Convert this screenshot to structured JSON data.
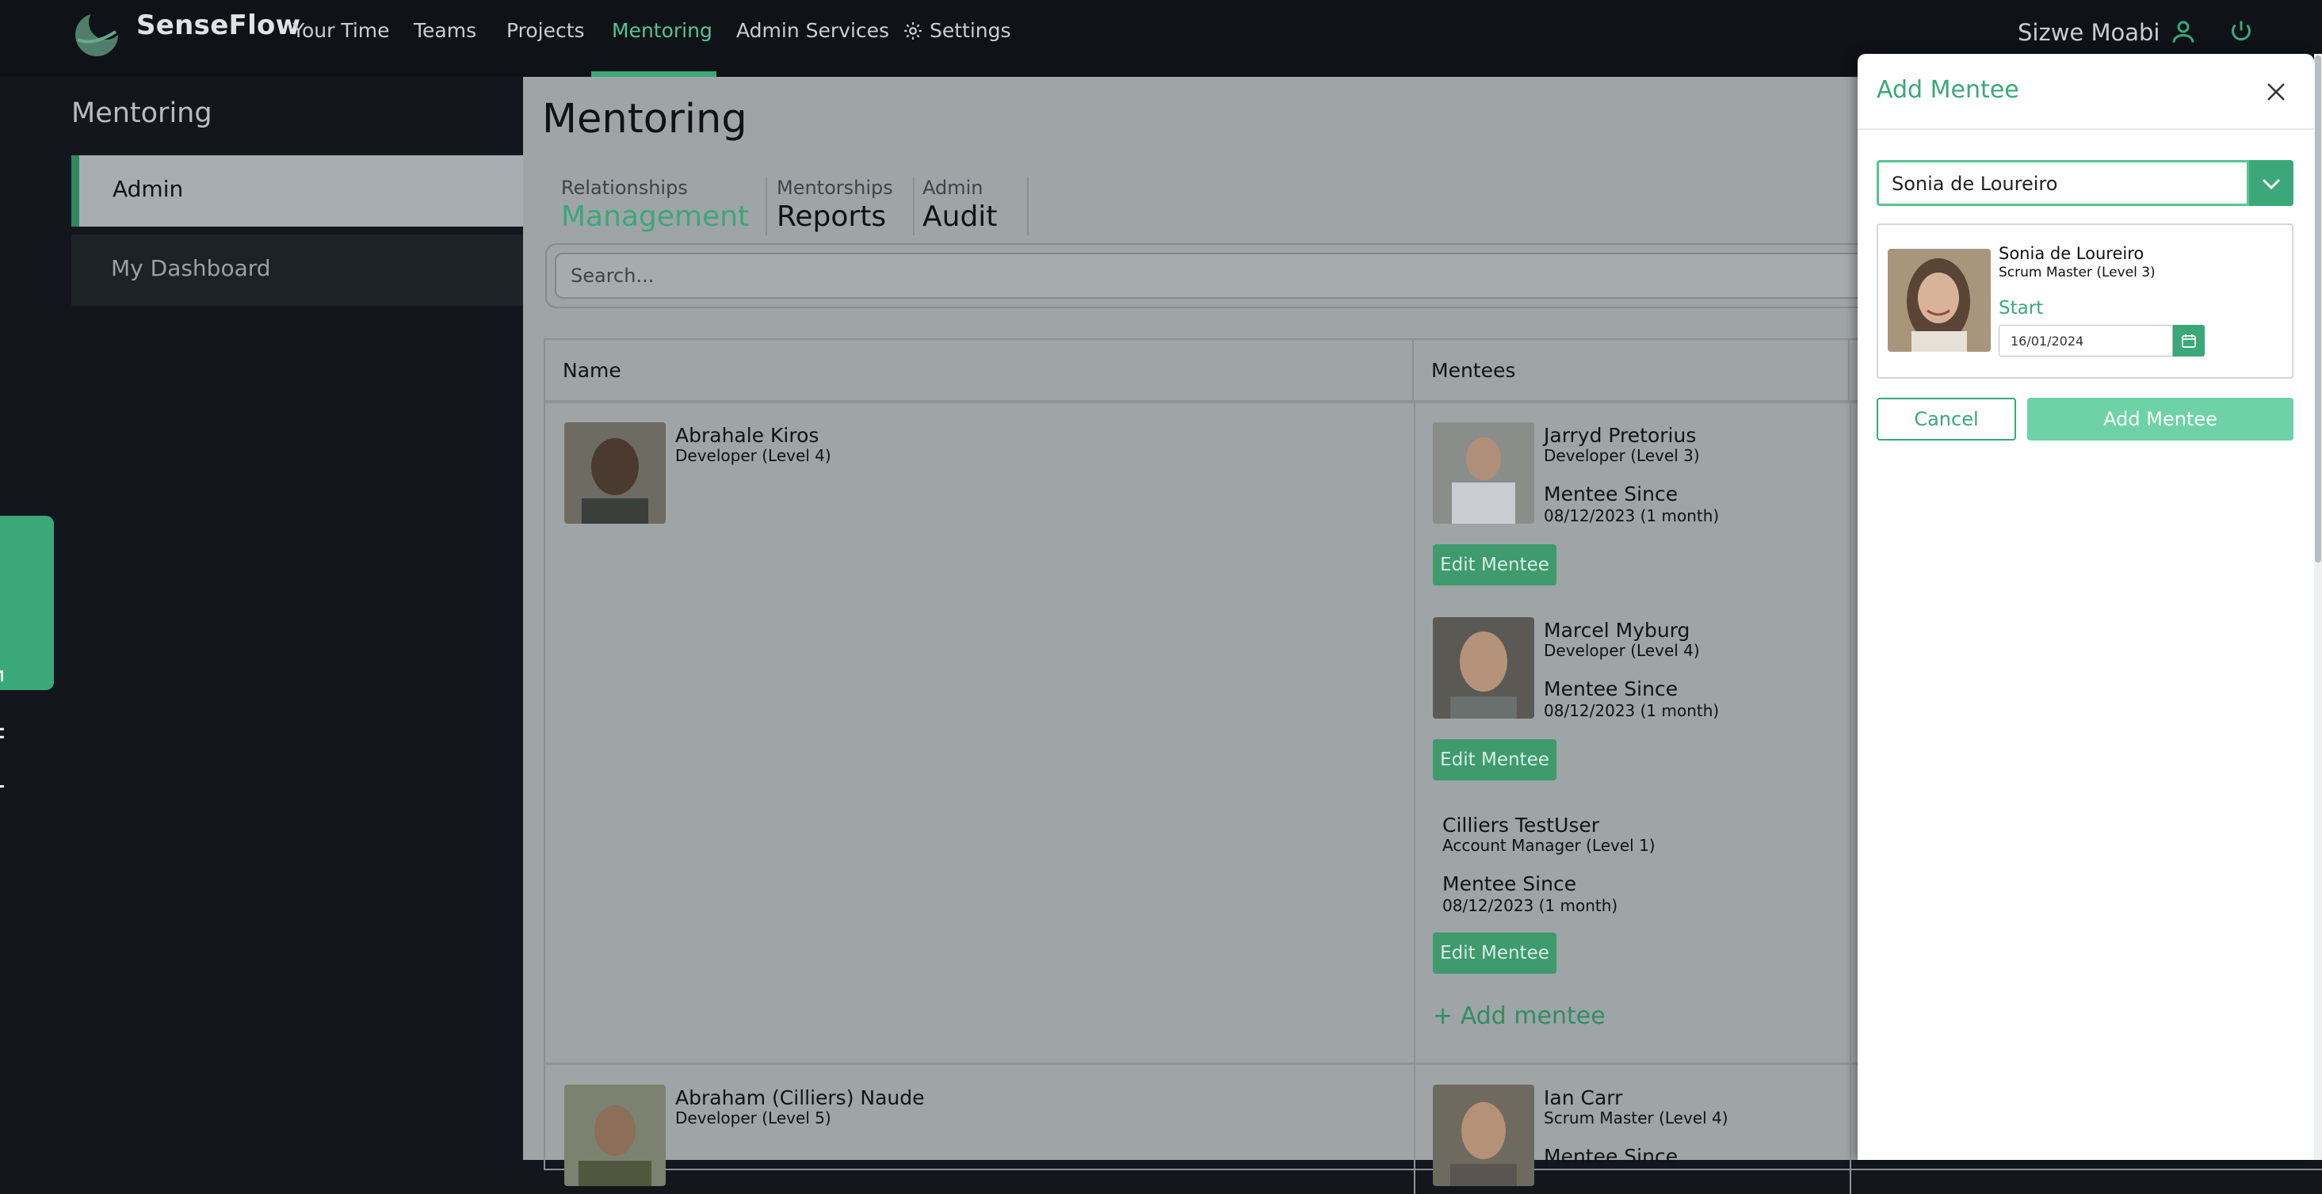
{
  "app": {
    "brand": "SenseFlow",
    "user": "Sizwe Moabi"
  },
  "nav": {
    "items": [
      "Your Time",
      "Teams",
      "Projects",
      "Mentoring",
      "Admin Services",
      "Settings"
    ],
    "active": "Mentoring"
  },
  "sidebar": {
    "title": "Mentoring",
    "items": [
      {
        "label": "Admin"
      },
      {
        "label": "My Dashboard"
      }
    ]
  },
  "feedback": {
    "label": "Feedback"
  },
  "main": {
    "title": "Mentoring",
    "tabs": [
      {
        "small": "Relationships",
        "big": "Management"
      },
      {
        "small": "Mentorships",
        "big": "Reports"
      },
      {
        "small": "Admin",
        "big": "Audit"
      }
    ],
    "search_placeholder": "Search..."
  },
  "table": {
    "columns": [
      "Name",
      "Mentees"
    ],
    "rows": [
      {
        "mentor": {
          "name": "Abrahale Kiros",
          "role": "Developer (Level 4)"
        },
        "mentees": [
          {
            "name": "Jarryd Pretorius",
            "role": "Developer (Level 3)",
            "since_label": "Mentee Since",
            "since": "08/12/2023 (1 month)",
            "button": "Edit Mentee"
          },
          {
            "name": "Marcel Myburg",
            "role": "Developer (Level 4)",
            "since_label": "Mentee Since",
            "since": "08/12/2023 (1 month)",
            "button": "Edit Mentee"
          },
          {
            "name": "Cilliers TestUser",
            "role": "Account Manager (Level 1)",
            "since_label": "Mentee Since",
            "since": "08/12/2023 (1 month)",
            "button": "Edit Mentee"
          }
        ],
        "add_label": "Add mentee"
      },
      {
        "mentor": {
          "name": "Abraham (Cilliers) Naude",
          "role": "Developer (Level 5)"
        },
        "mentees": [
          {
            "name": "Ian Carr",
            "role": "Scrum Master (Level 4)",
            "since_label": "Mentee Since"
          }
        ]
      }
    ]
  },
  "panel": {
    "title": "Add Mentee",
    "selected": "Sonia de Loureiro",
    "candidate": {
      "name": "Sonia de Loureiro",
      "role": "Scrum Master (Level 3)"
    },
    "start_label": "Start",
    "start_date": "16/01/2024",
    "cancel": "Cancel",
    "submit": "Add Mentee"
  },
  "colors": {
    "accent": "#3aa878",
    "nav_bg": "#0f1318",
    "overlay": "#9fa4a7"
  }
}
